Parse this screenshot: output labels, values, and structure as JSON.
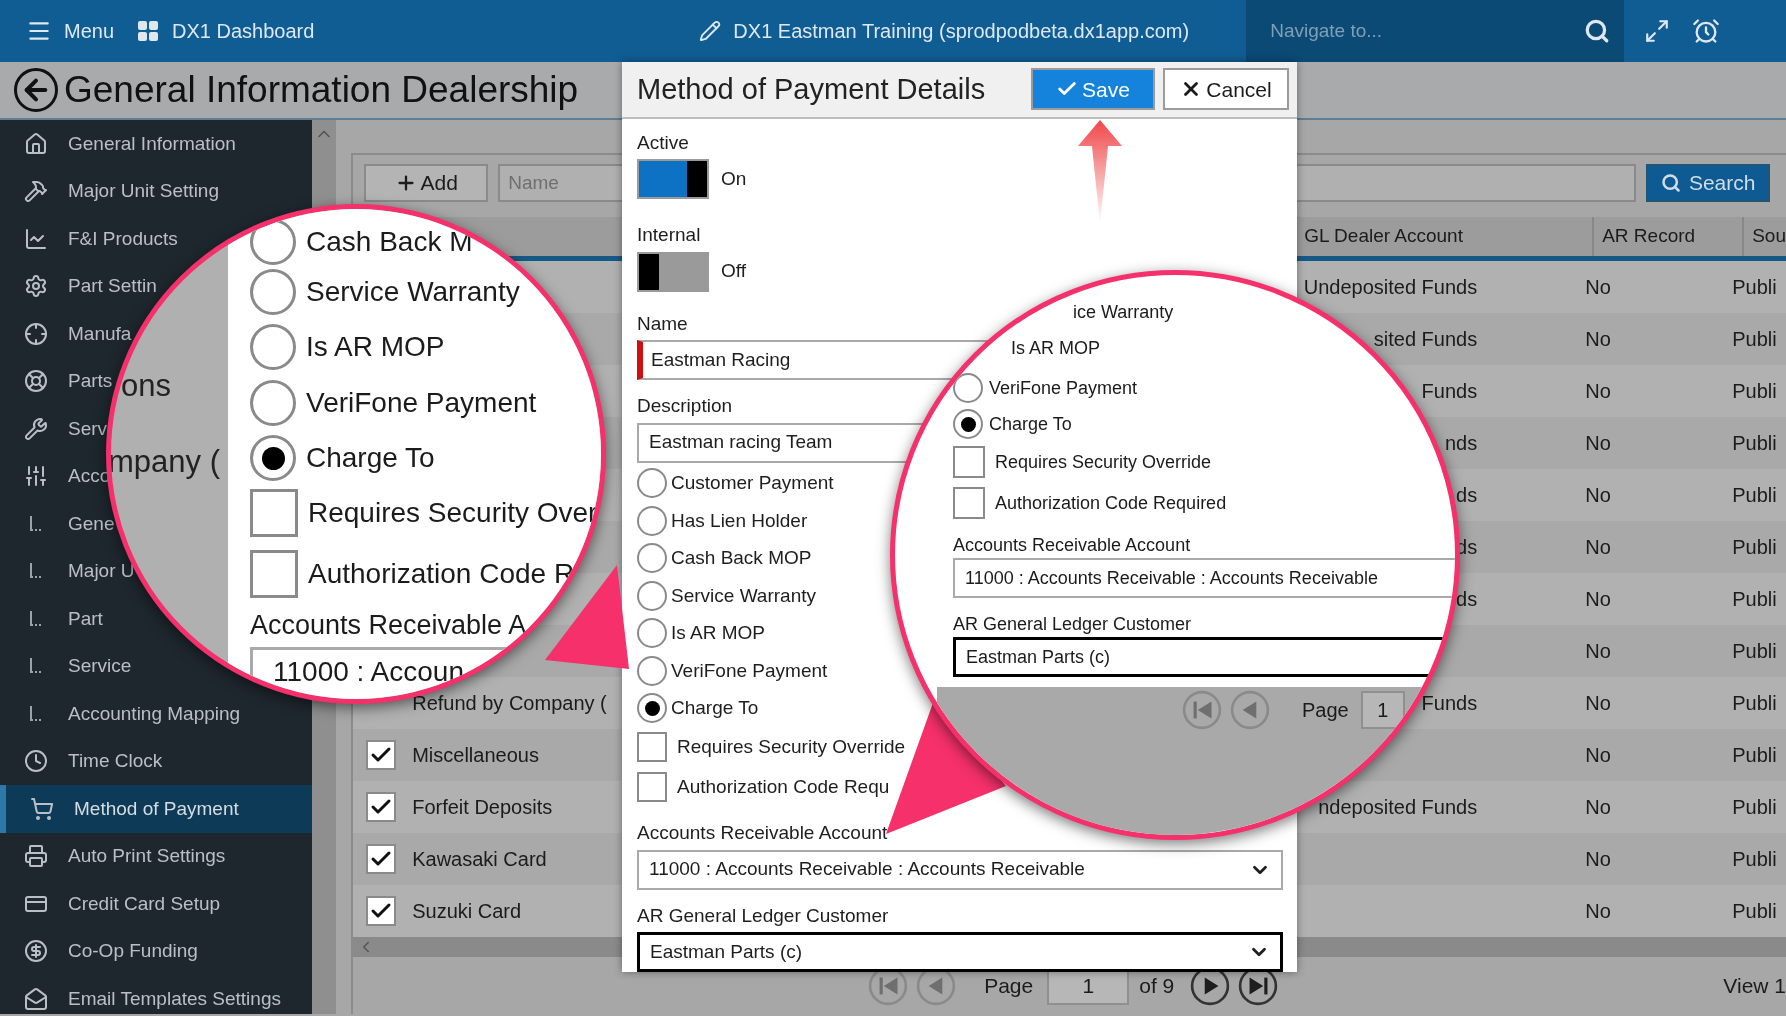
{
  "top_bar": {
    "menu": "Menu",
    "dashboard": "DX1 Dashboard",
    "environment": "DX1 Eastman Training (sprodpodbeta.dx1app.com)",
    "navigate": {
      "placeholder": "Navigate to..."
    }
  },
  "page_title": "General Information Dealership",
  "sidebar": {
    "items": [
      {
        "label": "General Information",
        "selected": false
      },
      {
        "label": "Major Unit Setting",
        "selected": false
      },
      {
        "label": "F&I Products",
        "selected": false
      },
      {
        "label": "Part Settin",
        "selected": false
      },
      {
        "label": "Manufa",
        "selected": false
      },
      {
        "label": "Parts",
        "selected": false
      },
      {
        "label": "Serv",
        "selected": false
      },
      {
        "label": "Acco",
        "selected": false
      },
      {
        "label": "Gene",
        "selected": false
      },
      {
        "label": "Major U",
        "selected": false
      },
      {
        "label": "Part",
        "selected": false
      },
      {
        "label": "Service",
        "selected": false
      },
      {
        "label": "Accounting Mapping",
        "selected": false
      },
      {
        "label": "Time Clock",
        "selected": false
      },
      {
        "label": "Method of Payment",
        "selected": true
      },
      {
        "label": "Auto Print Settings",
        "selected": false
      },
      {
        "label": "Credit Card Setup",
        "selected": false
      },
      {
        "label": "Co-Op Funding",
        "selected": false
      },
      {
        "label": "Email Templates Settings",
        "selected": false
      }
    ]
  },
  "toolbar": {
    "add": "Add",
    "name": {
      "placeholder": "Name"
    },
    "search": "Search"
  },
  "table": {
    "columns": [
      "GL Dealer Account",
      "AR Record",
      "Sou"
    ],
    "rows": [
      {
        "gl": "Undeposited Funds",
        "ar": "No",
        "source": "Publi"
      },
      {
        "gl": "sited Funds",
        "ar": "No",
        "source": "Publi"
      },
      {
        "gl": "Funds",
        "ar": "No",
        "source": "Publi"
      },
      {
        "gl": "nds",
        "ar": "No",
        "source": "Publi"
      },
      {
        "gl": "ds",
        "ar": "No",
        "source": "Publi"
      },
      {
        "gl": "ds",
        "ar": "No",
        "source": "Publi"
      },
      {
        "gl": "ds",
        "ar": "No",
        "source": "Publi"
      },
      {
        "ar": "No",
        "source": "Publi"
      },
      {
        "name": "Refund by Company (",
        "gl": "Funds",
        "ar": "No",
        "source": "Publi"
      },
      {
        "name": "Miscellaneous",
        "checked": true,
        "ar": "No",
        "source": "Publi"
      },
      {
        "name": "Forfeit Deposits",
        "checked": true,
        "gl": "ndeposited Funds",
        "ar": "No",
        "source": "Publi"
      },
      {
        "name": "Kawasaki Card",
        "checked": true,
        "ar": "No",
        "source": "Publi"
      },
      {
        "name": "Suzuki Card",
        "checked": true,
        "ar": "No",
        "source": "Publi"
      }
    ]
  },
  "pager": {
    "page_label": "Page",
    "page": "1",
    "of": "of 9",
    "view": "View 1"
  },
  "dialog": {
    "title": "Method of Payment Details",
    "save": "Save",
    "cancel": "Cancel",
    "active": {
      "label": "Active",
      "on": true,
      "state": "On"
    },
    "internal": {
      "label": "Internal",
      "on": false,
      "state": "Off"
    },
    "name": {
      "label": "Name",
      "value": "Eastman Racing"
    },
    "description": {
      "label": "Description",
      "value": "Eastman racing Team"
    },
    "options": [
      {
        "kind": "radio",
        "label": "Customer Payment",
        "selected": false
      },
      {
        "kind": "radio",
        "label": "Has Lien Holder",
        "selected": false
      },
      {
        "kind": "radio",
        "label": "Cash Back MOP",
        "selected": false
      },
      {
        "kind": "radio",
        "label": "Service Warranty",
        "selected": false
      },
      {
        "kind": "radio",
        "label": "Is AR MOP",
        "selected": false
      },
      {
        "kind": "radio",
        "label": "VeriFone Payment",
        "selected": false
      },
      {
        "kind": "radio",
        "label": "Charge To",
        "selected": true
      },
      {
        "kind": "checkbox",
        "label": "Requires Security Override",
        "checked": false
      },
      {
        "kind": "checkbox",
        "label": "Authorization Code Requ",
        "checked": false
      }
    ],
    "ar_account": {
      "label": "Accounts Receivable Account",
      "value": "11000 : Accounts Receivable : Accounts Receivable"
    },
    "ar_customer": {
      "label": "AR General Ledger Customer",
      "value": "Eastman Parts (c)"
    }
  },
  "magnifier_left": {
    "side_texts": [
      "ons",
      "mpany ("
    ],
    "options": [
      {
        "kind": "radio",
        "label": "Cash Back M",
        "selected": false
      },
      {
        "kind": "radio",
        "label": "Service Warranty",
        "selected": false
      },
      {
        "kind": "radio",
        "label": "Is AR MOP",
        "selected": false
      },
      {
        "kind": "radio",
        "label": "VeriFone Payment",
        "selected": false
      },
      {
        "kind": "radio",
        "label": "Charge To",
        "selected": true
      },
      {
        "kind": "checkbox",
        "label": "Requires Security Over",
        "checked": false
      },
      {
        "kind": "checkbox",
        "label": "Authorization Code R",
        "checked": false
      }
    ],
    "ar_account": {
      "label": "Accounts Receivable A",
      "value": "11000 : Accoun"
    }
  },
  "magnifier_right": {
    "options": [
      {
        "kind": "radio",
        "label": "ice Warranty"
      },
      {
        "kind": "radio",
        "label": "Is AR MOP"
      },
      {
        "kind": "radio",
        "label": "VeriFone Payment",
        "selected": false
      },
      {
        "kind": "radio",
        "label": "Charge To",
        "selected": true
      },
      {
        "kind": "checkbox",
        "label": "Requires Security Override",
        "checked": false
      },
      {
        "kind": "checkbox",
        "label": "Authorization Code Required",
        "checked": false
      }
    ],
    "ar_account": {
      "label": "Accounts Receivable Account",
      "value": "11000 : Accounts Receivable : Accounts Receivable"
    },
    "ar_customer": {
      "label": "AR General Ledger Customer",
      "value": "Eastman Parts (c)"
    },
    "pager": {
      "page_label": "Page",
      "page": "1"
    }
  }
}
